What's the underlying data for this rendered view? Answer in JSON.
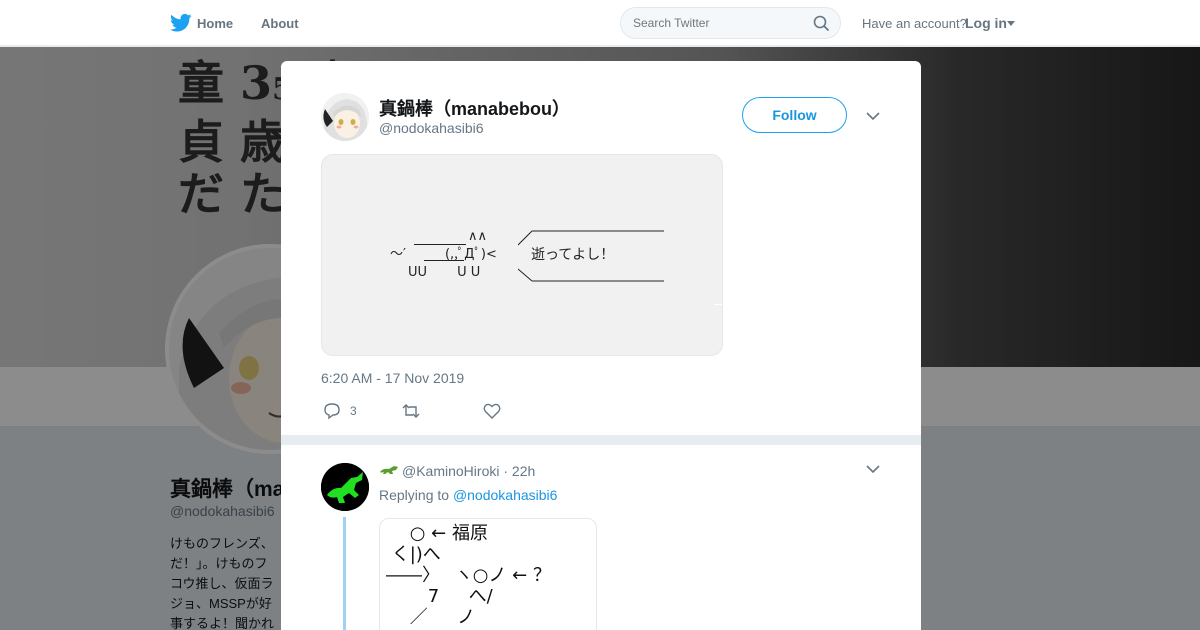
{
  "nav": {
    "home_label": "Home",
    "about_label": "About",
    "search_placeholder": "Search Twitter",
    "have_account": "Have an account?",
    "login_label": "Log in"
  },
  "background_profile": {
    "banner_text": "童 3\n貞 歳\nだ た",
    "name": "真鍋棒（ma",
    "handle": "@nodokahasibi6",
    "bio": "けものフレンズ、\nだ！」。けものフ\nコウ推し、仮面ラ\nジョ、MSSPが好\n事するよ！聞かれ"
  },
  "tweet": {
    "display_name": "真鍋棒（manabebou）",
    "handle": "@nodokahasibi6",
    "follow_label": "Follow",
    "ascii_art": {
      "ears": "∧∧",
      "body": "～′　　　(,,ﾟДﾟ)<",
      "feet": "UU　　 U U",
      "speech": "逝ってよし！"
    },
    "timestamp": "6:20 AM - 17 Nov 2019",
    "reply_count": "3"
  },
  "reply": {
    "handle": "@KaminoHiroki",
    "time": "22h",
    "replying_prefix": "Replying to",
    "replying_to": "@nodokahasibi6",
    "ascii_art": [
      "　 ○ ← 福原",
      " く|)へ",
      "――〉　 ヽ○ノ ← ？",
      "　　 7　  へ/",
      "　 ／　  ノ"
    ]
  },
  "colors": {
    "twitter_blue": "#1da1f2",
    "link_blue": "#1b95e0",
    "muted": "#657786"
  }
}
